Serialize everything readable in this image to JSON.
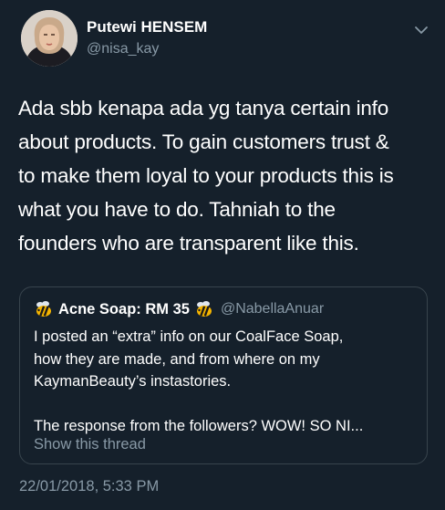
{
  "author": {
    "display_name": "Putewi HENSEM",
    "handle": "@nisa_kay",
    "avatar_icon": "profile-photo"
  },
  "tweet": {
    "lines": [
      "Ada sbb kenapa ada yg tanya certain info",
      "about products. To gain customers trust &",
      "to make them loyal to your products this is",
      "what you have to do. Tahniah to the",
      "founders who are transparent like this."
    ],
    "timestamp": "22/01/2018, 5:33 PM"
  },
  "quoted_tweet": {
    "display_name": "Acne Soap: RM 35",
    "handle": "@NabellaAnuar",
    "name_emoji": "bee-icon",
    "text_lines": [
      "I posted an “extra” info on our CoalFace Soap,",
      "how they are made, and from where on my",
      "KaymanBeauty’s instastories."
    ],
    "text_line_after_break": "The response from the followers? WOW! SO NI...",
    "show_thread_label": "Show this thread"
  },
  "colors": {
    "background": "#15202b",
    "text_primary": "#ffffff",
    "text_secondary": "#8899a6",
    "border": "#38444d"
  }
}
